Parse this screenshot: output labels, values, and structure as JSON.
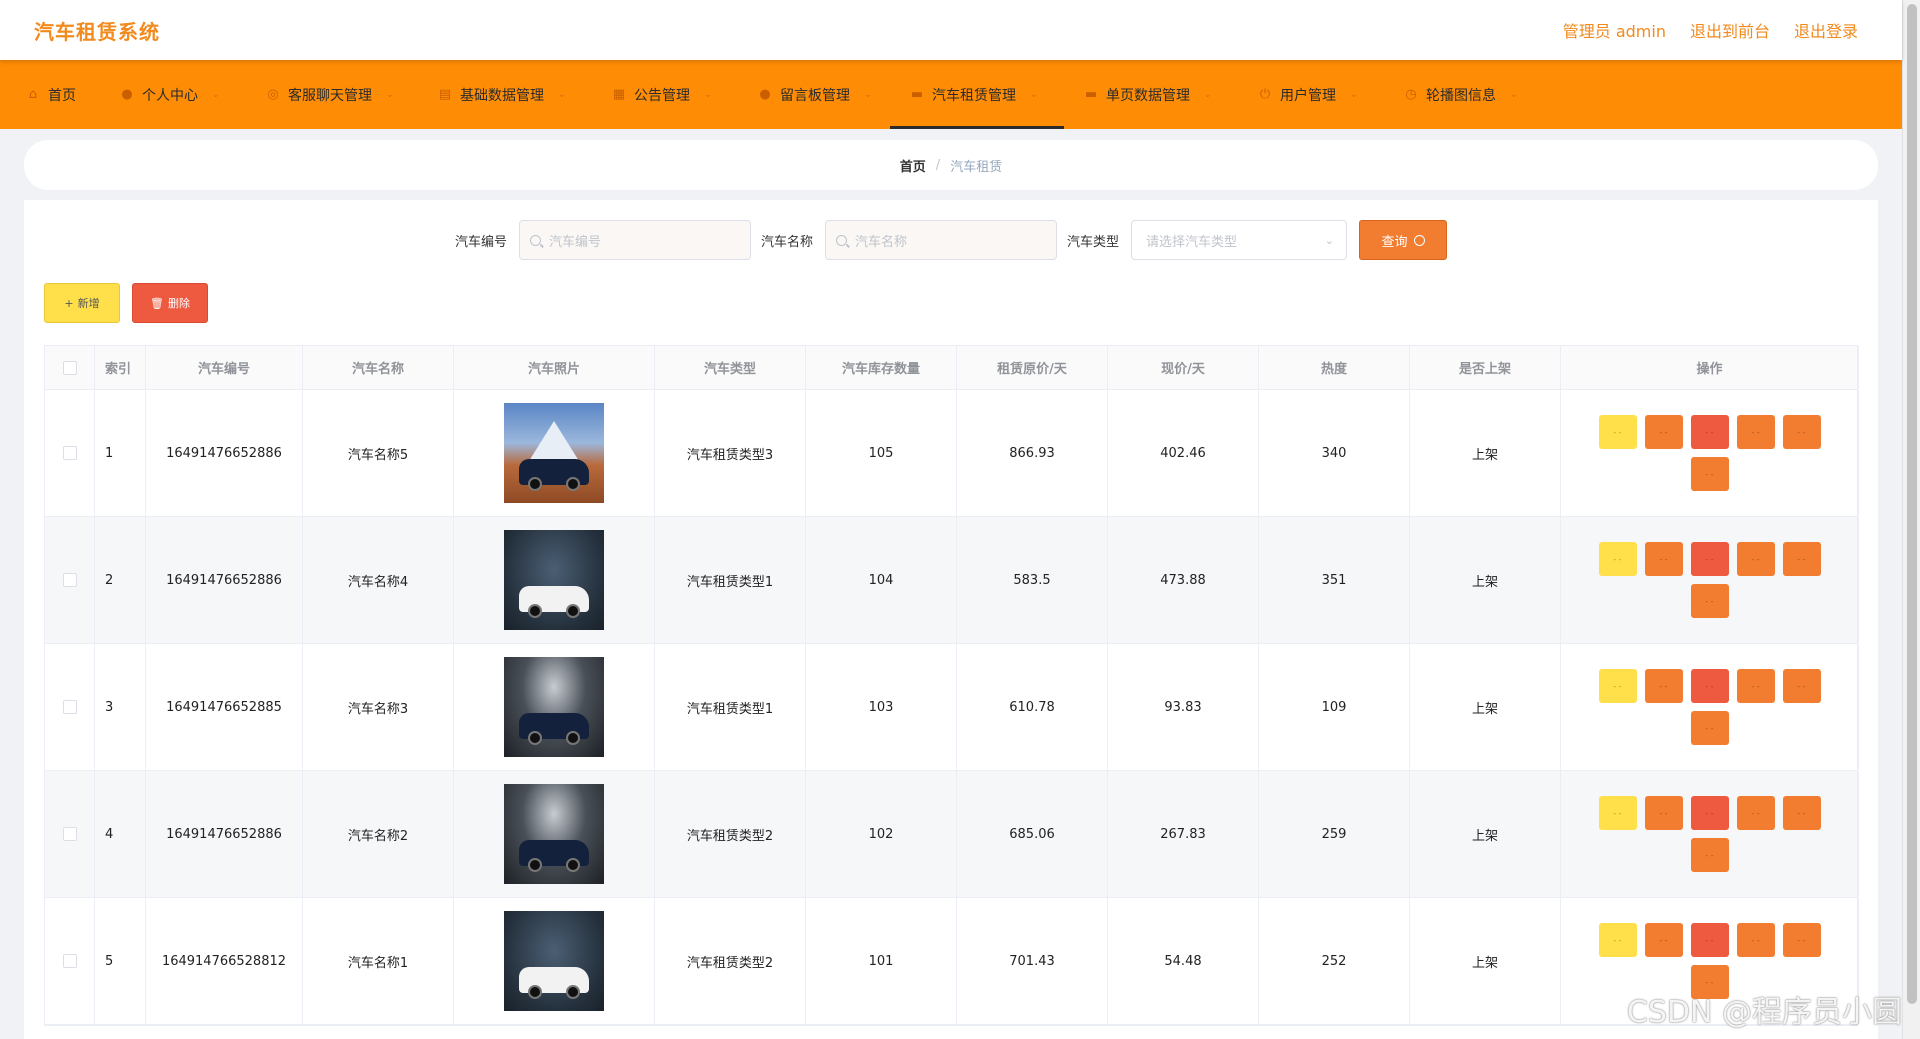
{
  "header": {
    "title": "汽车租赁系统",
    "links": [
      "管理员 admin",
      "退出到前台",
      "退出登录"
    ]
  },
  "nav": {
    "items": [
      {
        "label": "首页",
        "icon": "home-icon"
      },
      {
        "label": "个人中心",
        "icon": "user-icon"
      },
      {
        "label": "客服聊天管理",
        "icon": "chat-icon"
      },
      {
        "label": "基础数据管理",
        "icon": "database-icon"
      },
      {
        "label": "公告管理",
        "icon": "notice-icon"
      },
      {
        "label": "留言板管理",
        "icon": "message-icon"
      },
      {
        "label": "汽车租赁管理",
        "icon": "car-icon"
      },
      {
        "label": "单页数据管理",
        "icon": "page-icon"
      },
      {
        "label": "用户管理",
        "icon": "users-icon"
      },
      {
        "label": "轮播图信息",
        "icon": "carousel-icon"
      }
    ]
  },
  "breadcrumb": {
    "home": "首页",
    "current": "汽车租赁"
  },
  "search": {
    "code_label": "汽车编号",
    "code_placeholder": "汽车编号",
    "name_label": "汽车名称",
    "name_placeholder": "汽车名称",
    "type_label": "汽车类型",
    "type_placeholder": "请选择汽车类型",
    "query_label": "查询"
  },
  "actions": {
    "add_label": "新增",
    "delete_label": "删除"
  },
  "table": {
    "headers": [
      "索引",
      "汽车编号",
      "汽车名称",
      "汽车照片",
      "汽车类型",
      "汽车库存数量",
      "租赁原价/天",
      "现价/天",
      "热度",
      "是否上架",
      "操作"
    ],
    "rows": [
      {
        "index": "1",
        "code": "16491476652886",
        "name": "汽车名称5",
        "type": "汽车租赁类型3",
        "stock": "105",
        "original_price": "866.93",
        "current_price": "402.46",
        "heat": "340",
        "status": "上架"
      },
      {
        "index": "2",
        "code": "16491476652886",
        "name": "汽车名称4",
        "type": "汽车租赁类型1",
        "stock": "104",
        "original_price": "583.5",
        "current_price": "473.88",
        "heat": "351",
        "status": "上架"
      },
      {
        "index": "3",
        "code": "16491476652885",
        "name": "汽车名称3",
        "type": "汽车租赁类型1",
        "stock": "103",
        "original_price": "610.78",
        "current_price": "93.83",
        "heat": "109",
        "status": "上架"
      },
      {
        "index": "4",
        "code": "16491476652886",
        "name": "汽车名称2",
        "type": "汽车租赁类型2",
        "stock": "102",
        "original_price": "685.06",
        "current_price": "267.83",
        "heat": "259",
        "status": "上架"
      },
      {
        "index": "5",
        "code": "164914766528812",
        "name": "汽车名称1",
        "type": "汽车租赁类型2",
        "stock": "101",
        "original_price": "701.43",
        "current_price": "54.48",
        "heat": "252",
        "status": "上架"
      }
    ]
  },
  "watermark": "CSDN @程序员小圆",
  "colors": {
    "primary": "#fe8c05",
    "accent_text": "#f28a1d",
    "yellow": "#ffe04b",
    "orange": "#f27d30",
    "red": "#ee5a40"
  }
}
